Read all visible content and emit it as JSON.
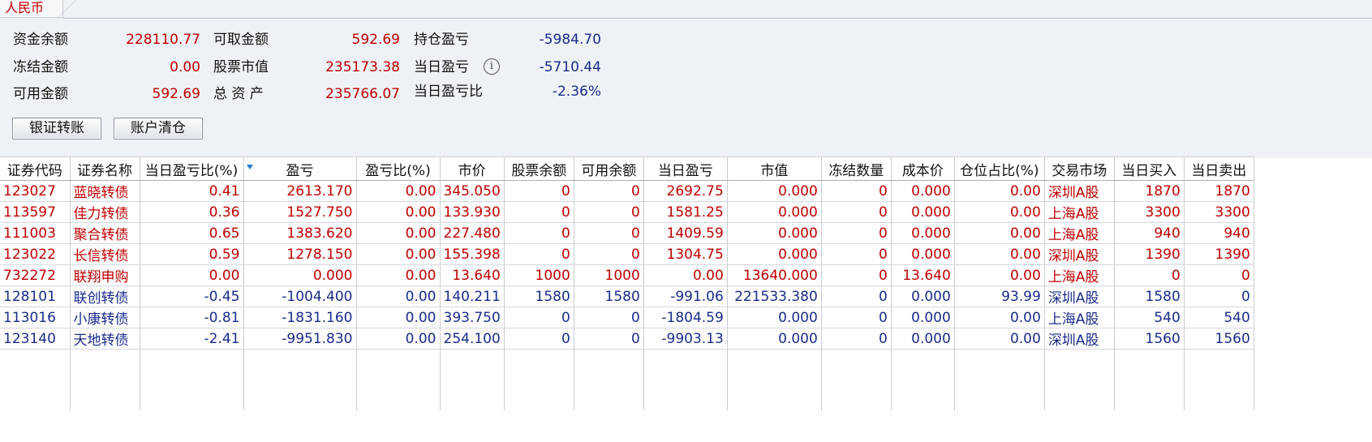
{
  "tab": {
    "label": "人民币"
  },
  "summary": {
    "zijin_yue": {
      "label": "资金余额",
      "value": "228110.77"
    },
    "dongjie": {
      "label": "冻结金额",
      "value": "0.00"
    },
    "keyong": {
      "label": "可用金额",
      "value": "592.69"
    },
    "kequ": {
      "label": "可取金额",
      "value": "592.69"
    },
    "gupiao_shizhi": {
      "label": "股票市值",
      "value": "235173.38"
    },
    "zong_zichan": {
      "label": "总 资 产",
      "value": "235766.07"
    },
    "chicang_yingkui": {
      "label": "持仓盈亏",
      "value": "-5984.70"
    },
    "dangri_yingkui": {
      "label": "当日盈亏",
      "value": "-5710.44"
    },
    "dangri_yingkui_bi": {
      "label": "当日盈亏比",
      "value": "-2.36%"
    }
  },
  "buttons": {
    "transfer": "银证转账",
    "clear": "账户清仓"
  },
  "colors": {
    "red": "#c00000",
    "blue": "#1a2b8c",
    "panel": "#eef2f6"
  },
  "table": {
    "headers": [
      "证券代码",
      "证券名称",
      "当日盈亏比(%)",
      "盈亏",
      "盈亏比(%)",
      "市价",
      "股票余额",
      "可用余额",
      "当日盈亏",
      "市值",
      "冻结数量",
      "成本价",
      "仓位占比(%)",
      "交易市场",
      "当日买入",
      "当日卖出"
    ],
    "rows": [
      {
        "color": "red",
        "cells": [
          "123027",
          "蓝晓转债",
          "0.41",
          "2613.170",
          "0.00",
          "345.050",
          "0",
          "0",
          "2692.75",
          "0.000",
          "0",
          "0.000",
          "0.00",
          "深圳A股",
          "1870",
          "1870"
        ]
      },
      {
        "color": "red",
        "cells": [
          "113597",
          "佳力转债",
          "0.36",
          "1527.750",
          "0.00",
          "133.930",
          "0",
          "0",
          "1581.25",
          "0.000",
          "0",
          "0.000",
          "0.00",
          "上海A股",
          "3300",
          "3300"
        ]
      },
      {
        "color": "red",
        "cells": [
          "111003",
          "聚合转债",
          "0.65",
          "1383.620",
          "0.00",
          "227.480",
          "0",
          "0",
          "1409.59",
          "0.000",
          "0",
          "0.000",
          "0.00",
          "上海A股",
          "940",
          "940"
        ]
      },
      {
        "color": "red",
        "cells": [
          "123022",
          "长信转债",
          "0.59",
          "1278.150",
          "0.00",
          "155.398",
          "0",
          "0",
          "1304.75",
          "0.000",
          "0",
          "0.000",
          "0.00",
          "深圳A股",
          "1390",
          "1390"
        ]
      },
      {
        "color": "red",
        "cells": [
          "732272",
          "联翔申购",
          "0.00",
          "0.000",
          "0.00",
          "13.640",
          "1000",
          "1000",
          "0.00",
          "13640.000",
          "0",
          "13.640",
          "0.00",
          "上海A股",
          "0",
          "0"
        ]
      },
      {
        "color": "blue",
        "cells": [
          "128101",
          "联创转债",
          "-0.45",
          "-1004.400",
          "0.00",
          "140.211",
          "1580",
          "1580",
          "-991.06",
          "221533.380",
          "0",
          "0.000",
          "93.99",
          "深圳A股",
          "1580",
          "0"
        ]
      },
      {
        "color": "blue",
        "cells": [
          "113016",
          "小康转债",
          "-0.81",
          "-1831.160",
          "0.00",
          "393.750",
          "0",
          "0",
          "-1804.59",
          "0.000",
          "0",
          "0.000",
          "0.00",
          "上海A股",
          "540",
          "540"
        ]
      },
      {
        "color": "blue",
        "cells": [
          "123140",
          "天地转债",
          "-2.41",
          "-9951.830",
          "0.00",
          "254.100",
          "0",
          "0",
          "-9903.13",
          "0.000",
          "0",
          "0.000",
          "0.00",
          "深圳A股",
          "1560",
          "1560"
        ]
      }
    ]
  }
}
